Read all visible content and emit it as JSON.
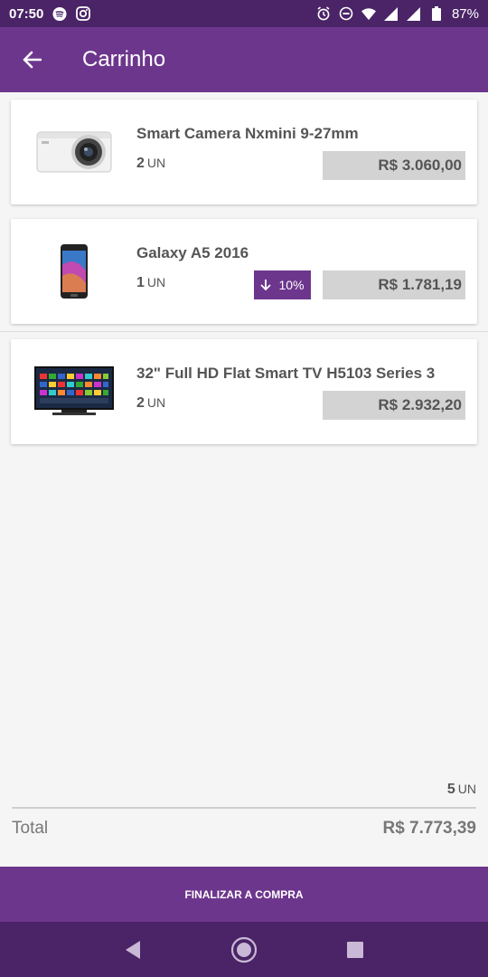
{
  "status_bar": {
    "time": "07:50",
    "battery": "87%",
    "icons_left": [
      "spotify-icon",
      "instagram-icon"
    ],
    "icons_right": [
      "alarm-icon",
      "do-not-disturb-icon",
      "wifi-icon",
      "signal-icon",
      "signal-icon",
      "battery-icon"
    ]
  },
  "app_bar": {
    "title": "Carrinho",
    "back_icon": "arrow-left-icon"
  },
  "cart": {
    "items": [
      {
        "name": "Smart Camera Nxmini 9-27mm",
        "qty": "2",
        "unit": "UN",
        "price": "R$ 3.060,00",
        "image": "camera"
      },
      {
        "name": "Galaxy A5 2016",
        "qty": "1",
        "unit": "UN",
        "price": "R$ 1.781,19",
        "discount": "10%",
        "image": "phone"
      },
      {
        "name": "32\" Full HD Flat Smart TV H5103 Series 3",
        "qty": "2",
        "unit": "UN",
        "price": "R$ 2.932,20",
        "image": "tv"
      }
    ]
  },
  "summary": {
    "units_qty": "5",
    "units_label": "UN",
    "total_label": "Total",
    "total_value": "R$ 7.773,39"
  },
  "checkout_button": {
    "label": "FINALIZAR A COMPRA"
  },
  "colors": {
    "primary": "#6d368d",
    "primary_dark": "#4a2466",
    "price_bg": "#d3d3d3"
  }
}
